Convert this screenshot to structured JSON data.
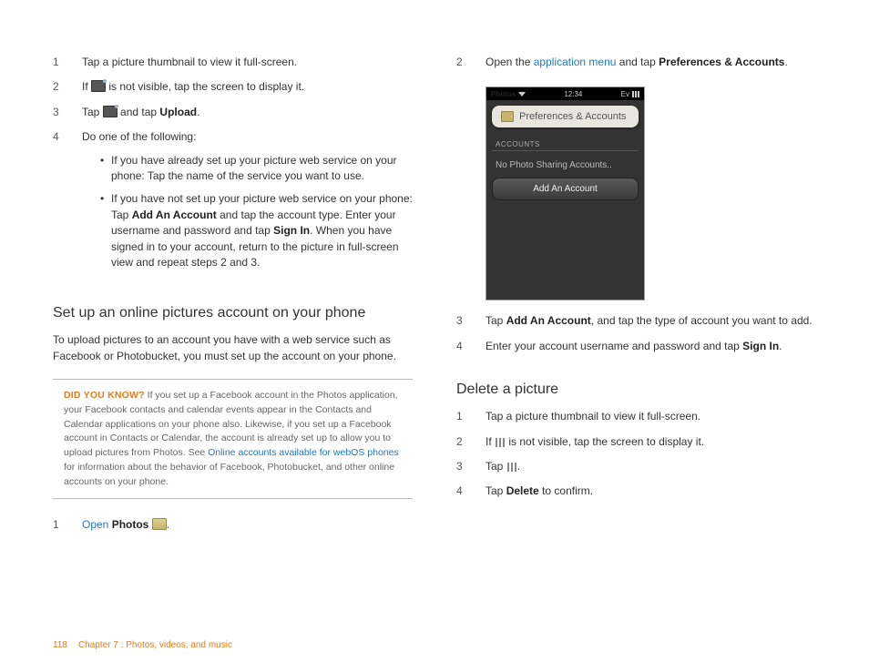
{
  "leftSteps": {
    "s1": "Tap a picture thumbnail to view it full-screen.",
    "s2a": "If ",
    "s2b": " is not visible, tap the screen to display it.",
    "s3a": "Tap ",
    "s3b": " and tap ",
    "s3c": "Upload",
    "s3d": ".",
    "s4": "Do one of the following:",
    "b1": "If you have already set up your picture web service on your phone: Tap the name of the service you want to use.",
    "b2a": "If you have not set up your picture web service on your phone: Tap ",
    "b2b": "Add An Account",
    "b2c": " and tap the account type. Enter your username and password and tap ",
    "b2d": "Sign In",
    "b2e": ". When you have signed in to your account, return to the picture in full-screen view and repeat steps 2 and 3."
  },
  "setup": {
    "heading": "Set up an online pictures account on your phone",
    "intro": "To upload pictures to an account you have with a web service such as Facebook or Photobucket, you must set up the account on your phone.",
    "tipLead": "DID YOU KNOW?",
    "tip1": "  If you set up a Facebook account in the Photos application, your Facebook contacts and calendar events appear in the Contacts and Calendar applications on your phone also. Likewise, if you set up a Facebook account in Contacts or Calendar, the account is already set up to allow you to upload pictures from Photos. See ",
    "tipLink": "Online accounts available for webOS phones",
    "tip2": " for information about the behavior of Facebook, Photobucket, and other online accounts on your phone.",
    "s1a": "Open",
    "s1b": " Photos ",
    "s1c": "."
  },
  "right": {
    "s2a": "Open the ",
    "s2link": "application menu",
    "s2b": " and tap ",
    "s2c": "Preferences & Accounts",
    "s2d": ".",
    "s3a": "Tap ",
    "s3b": "Add An Account",
    "s3c": ", and tap the type of account you want to add.",
    "s4a": "Enter your account username and password and tap ",
    "s4b": "Sign In",
    "s4c": "."
  },
  "delete": {
    "heading": "Delete a picture",
    "s1": "Tap a picture thumbnail to view it full-screen.",
    "s2a": "If ",
    "s2b": " is not visible, tap the screen to display it.",
    "s3a": "Tap ",
    "s3b": ".",
    "s4a": "Tap ",
    "s4b": "Delete",
    "s4c": " to confirm."
  },
  "phone": {
    "appname": "Photos",
    "time": "12:34",
    "ev": "Ev",
    "panel": "Preferences & Accounts",
    "section": "ACCOUNTS",
    "empty": "No Photo Sharing Accounts..",
    "button": "Add An Account"
  },
  "footer": {
    "page": "118",
    "chapter": "Chapter 7 : Photos, videos, and music"
  }
}
